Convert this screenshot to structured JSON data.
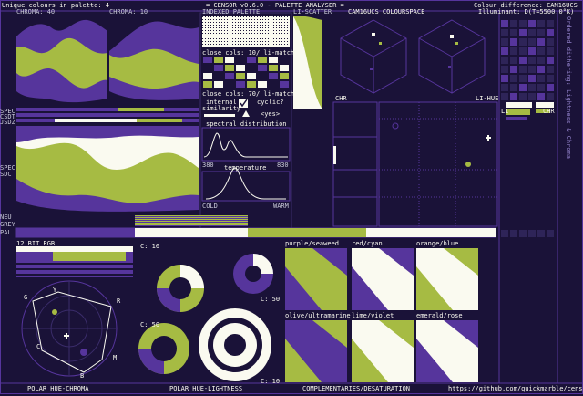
{
  "colors": {
    "bg": "#1a1238",
    "panel": "#241a48",
    "purple": "#56359c",
    "lime": "#a6bb43",
    "cream": "#fafaf0",
    "grey": "#8c8ca0"
  },
  "header": {
    "unique_colours": "Unique colours in palette: 4",
    "app_title": "= CENSOR v0.6.0 - PALETTE ANALYSER =",
    "colour_difference": "Colour difference: CAM16UCS",
    "illuminant": "Illuminant: D(T=5500.0°K)"
  },
  "top_labels": {
    "chroma_a": "CHROMA: 40",
    "chroma_b": "CHROMA: 10",
    "indexed_palette": "INDEXED PALETTE",
    "li_scatter": "LI-SCATTER",
    "colourspace": "CAM16UCS COLOURSPACE"
  },
  "left_labels": {
    "spec": "SPEC",
    "csdt": "CSDT",
    "jsdz": "JSDZ",
    "spec2": "SPEC",
    "sdc": "SDC",
    "neu": "NEU",
    "grey": "GREY",
    "pal": "PAL"
  },
  "indexed": {
    "close_cols_1": "close cols: 10/ li-match",
    "close_cols_2": "close cols: 70/ li-match",
    "internal_similarity_1": "internal",
    "internal_similarity_2": "similarity",
    "cyclic": "cyclic?",
    "yes": "<yes>",
    "spectral": "spectral distribution",
    "range_lo": "380",
    "range_hi": "830",
    "temperature": "temperature",
    "cold": "COLD",
    "warm": "WARM"
  },
  "plot_labels": {
    "chr": "CHR",
    "li_hue": "LI-HUE",
    "li": "LI",
    "chr2": "CHR"
  },
  "right_vertical": "Ordered dithering: Lightness & Chroma",
  "bit_rgb": "12 BIT RGB",
  "polar": {
    "labels": [
      "G",
      "Y",
      "R",
      "C",
      "B",
      "M"
    ],
    "hue_chroma": "POLAR HUE-CHROMA",
    "hue_lightness": "POLAR HUE-LIGHTNESS"
  },
  "rings": {
    "c10_a": "C: 10",
    "c50_a": "C: 50",
    "c50_b": "C: 50",
    "c10_b": "C: 10"
  },
  "complementaries": {
    "title": "COMPLEMENTARIES/DESATURATION",
    "pairs": [
      "purple/seaweed",
      "red/cyan",
      "orange/blue",
      "olive/ultramarine",
      "lime/violet",
      "emerald/rose"
    ]
  },
  "footer_url": "https://github.com/quickmarble/censor"
}
